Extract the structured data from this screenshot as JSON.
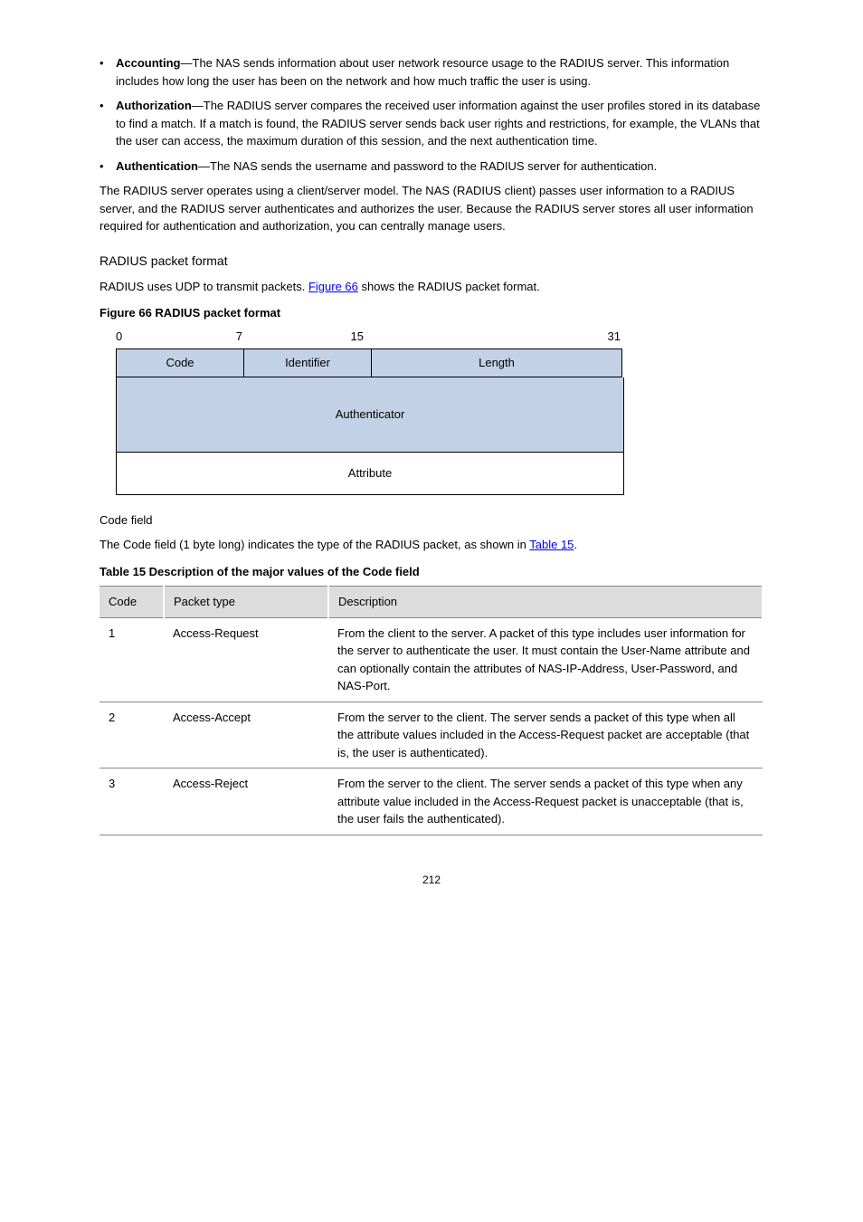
{
  "bullets": [
    {
      "label": "Accounting",
      "text": "—The NAS sends information about user network resource usage to the RADIUS server. This information includes how long the user has been on the network and how much traffic the user is using."
    },
    {
      "label": "Authorization",
      "text": "—The RADIUS server compares the received user information against the user profiles stored in its database to find a match. If a match is found, the RADIUS server sends back user rights and restrictions, for example, the VLANs that the user can access, the maximum duration of this session, and the next authentication time."
    },
    {
      "label": "Authentication",
      "text": "—The NAS sends the username and password to the RADIUS server for authentication."
    }
  ],
  "para1": "The RADIUS server operates using a client/server model. The NAS (RADIUS client) passes user information to a RADIUS server, and the RADIUS server authenticates and authorizes the user. Because the RADIUS server stores all user information required for authentication and authorization, you can centrally manage users.",
  "headingFormat": "RADIUS packet format",
  "para2_a": "RADIUS uses UDP to transmit packets. ",
  "para2_link": "Figure 66",
  "para2_b": " shows the RADIUS packet format.",
  "figCaption": "Figure 66 RADIUS packet format",
  "bits": {
    "b0": "0",
    "b7": "7",
    "b15": "15",
    "b31": "31"
  },
  "packet": {
    "code": "Code",
    "id": "Identifier",
    "len": "Length",
    "auth": "Authenticator",
    "attr": "Attribute"
  },
  "headingCode": "Code field",
  "para3_a": "The Code field (1 byte long) indicates the type of the RADIUS packet, as shown in ",
  "para3_link": "Table 15",
  "para3_b": ".",
  "tableCaption": "Table 15 Description of the major values of the Code field",
  "tableHeaders": {
    "code": "Code",
    "type": "Packet type",
    "desc": "Description"
  },
  "rows": [
    {
      "code": "1",
      "type": "Access-Request",
      "desc": "From the client to the server. A packet of this type includes user information for the server to authenticate the user. It must contain the User-Name attribute and can optionally contain the attributes of NAS-IP-Address, User-Password, and NAS-Port."
    },
    {
      "code": "2",
      "type": "Access-Accept",
      "desc": "From the server to the client. The server sends a packet of this type when all the attribute values included in the Access-Request packet are acceptable (that is, the user is authenticated)."
    },
    {
      "code": "3",
      "type": "Access-Reject",
      "desc": "From the server to the client. The server sends a packet of this type when any attribute value included in the Access-Request packet is unacceptable (that is, the user fails the authenticated)."
    }
  ],
  "pageNum": "212"
}
